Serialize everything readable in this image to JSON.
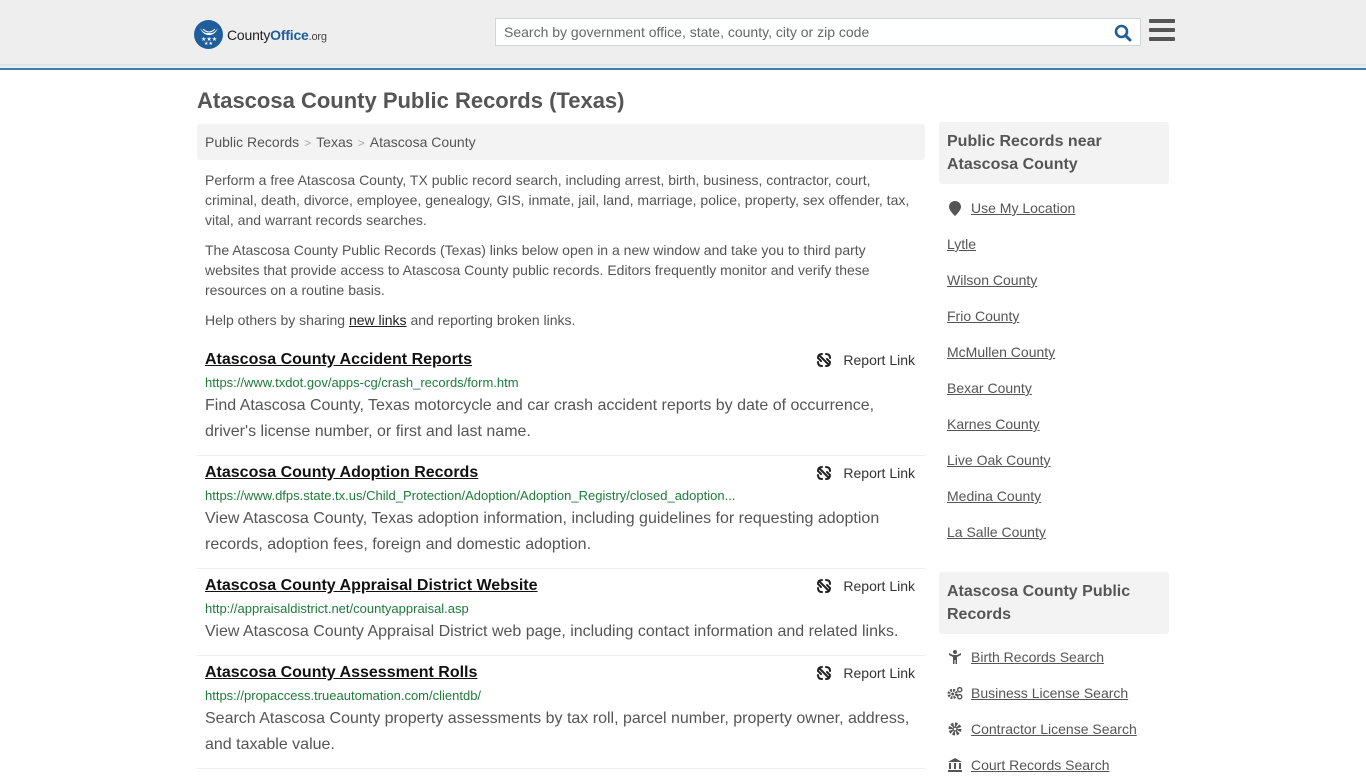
{
  "header": {
    "logo": {
      "name": "County",
      "brand": "Office",
      "tld": ".org"
    },
    "search": {
      "placeholder": "Search by government office, state, county, city or zip code",
      "value": ""
    },
    "icons": {
      "search": "search-icon",
      "menu": "hamburger-menu-icon"
    }
  },
  "page": {
    "title": "Atascosa County Public Records (Texas)",
    "breadcrumb": [
      "Public Records",
      "Texas",
      "Atascosa County"
    ],
    "intro": {
      "p1": "Perform a free Atascosa County, TX public record search, including arrest, birth, business, contractor, court, criminal, death, divorce, employee, genealogy, GIS, inmate, jail, land, marriage, police, property, sex offender, tax, vital, and warrant records searches.",
      "p2": "The Atascosa County Public Records (Texas) links below open in a new window and take you to third party websites that provide access to Atascosa County public records. Editors frequently monitor and verify these resources on a routine basis.",
      "p3_before": "Help others by sharing ",
      "p3_link": "new links",
      "p3_after": " and reporting broken links."
    }
  },
  "records": [
    {
      "title": "Atascosa County Accident Reports",
      "url": "https://www.txdot.gov/apps-cg/crash_records/form.htm",
      "description": "Find Atascosa County, Texas motorcycle and car crash accident reports by date of occurrence, driver's license number, or first and last name.",
      "report_label": "Report Link"
    },
    {
      "title": "Atascosa County Adoption Records",
      "url": "https://www.dfps.state.tx.us/Child_Protection/Adoption/Adoption_Registry/closed_adoption...",
      "description": "View Atascosa County, Texas adoption information, including guidelines for requesting adoption records, adoption fees, foreign and domestic adoption.",
      "report_label": "Report Link"
    },
    {
      "title": "Atascosa County Appraisal District Website",
      "url": "http://appraisaldistrict.net/countyappraisal.asp",
      "description": "View Atascosa County Appraisal District web page, including contact information and related links.",
      "report_label": "Report Link"
    },
    {
      "title": "Atascosa County Assessment Rolls",
      "url": "https://propaccess.trueautomation.com/clientdb/",
      "description": "Search Atascosa County property assessments by tax roll, parcel number, property owner, address, and taxable value.",
      "report_label": "Report Link"
    }
  ],
  "sidebar": {
    "nearby": {
      "heading": "Public Records near Atascosa County",
      "use_location": "Use My Location",
      "places": [
        "Lytle",
        "Wilson County",
        "Frio County",
        "McMullen County",
        "Bexar County",
        "Karnes County",
        "Live Oak County",
        "Medina County",
        "La Salle County"
      ]
    },
    "county_records": {
      "heading": "Atascosa County Public Records",
      "items": [
        {
          "label": "Birth Records Search",
          "icon": "child-icon"
        },
        {
          "label": "Business License Search",
          "icon": "cogs-icon"
        },
        {
          "label": "Contractor License Search",
          "icon": "gear-icon"
        },
        {
          "label": "Court Records Search",
          "icon": "courthouse-icon"
        }
      ]
    }
  },
  "colors": {
    "brand_blue": "#1f5d9c",
    "header_border": "#3b7fad",
    "url_green": "#1f7a3a",
    "text_gray": "#555555"
  }
}
